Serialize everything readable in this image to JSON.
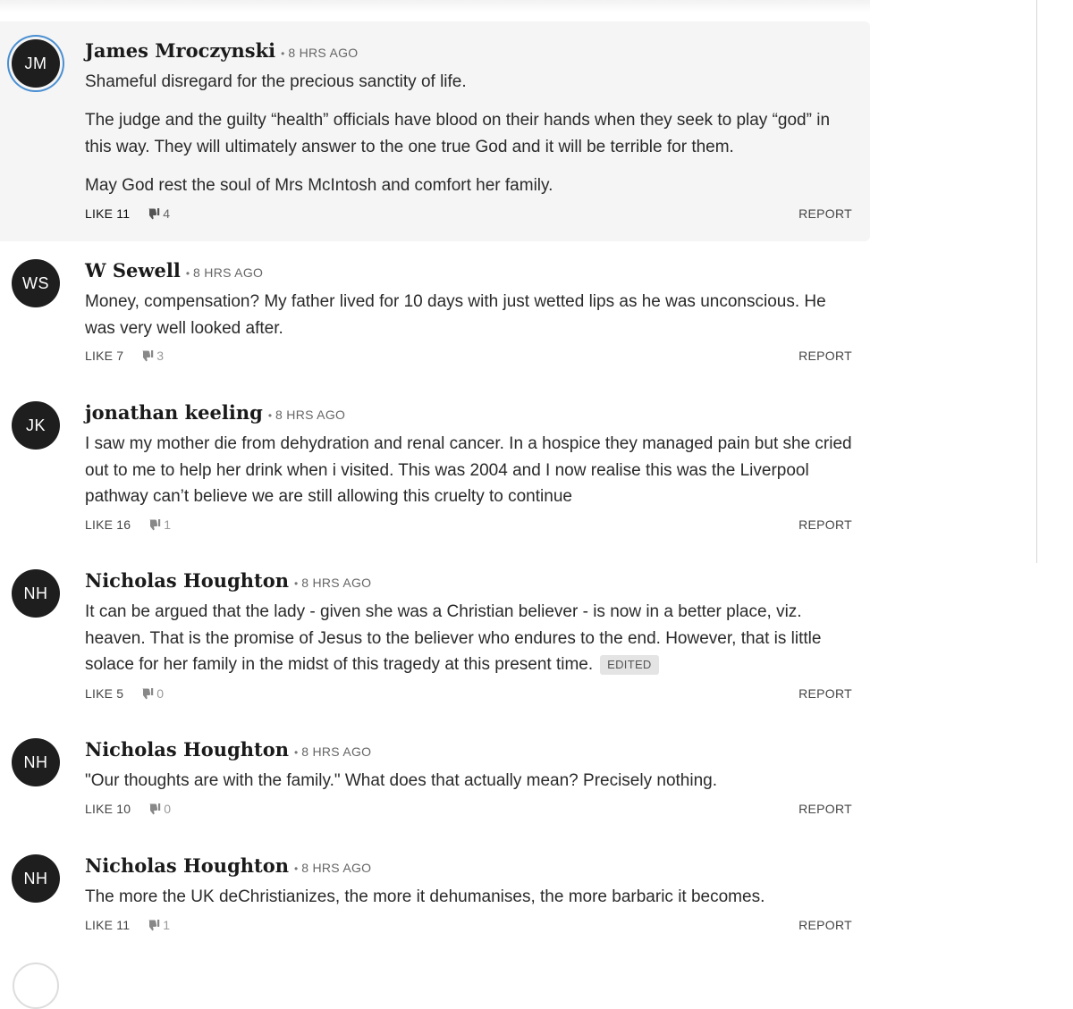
{
  "comments": [
    {
      "initials": "JM",
      "author": "James Mroczynski",
      "time": "8 HRS AGO",
      "paragraphs": [
        "Shameful disregard for the precious sanctity of life.",
        "The judge and the guilty “health” officials have blood on their hands when they seek to play “god” in this way. They will ultimately answer to the one true God and it will be terrible for them.",
        "May God rest the soul of Mrs McIntosh and comfort her family."
      ],
      "like_label": "LIKE 11",
      "dislike_count": "4",
      "report_label": "REPORT"
    },
    {
      "initials": "WS",
      "author": "W Sewell",
      "time": "8 HRS AGO",
      "paragraphs": [
        "Money, compensation? My father lived for 10 days with just wetted lips as he was unconscious. He was very well looked after."
      ],
      "like_label": "LIKE 7",
      "dislike_count": "3",
      "report_label": "REPORT"
    },
    {
      "initials": "JK",
      "author": "jonathan keeling",
      "time": "8 HRS AGO",
      "paragraphs": [
        "I saw my mother die from dehydration and renal cancer. In a hospice they managed pain but she cried out to me to help her drink when i visited. This was 2004 and I now realise this was the Liverpool pathway can’t believe we are still allowing this cruelty to continue"
      ],
      "like_label": "LIKE 16",
      "dislike_count": "1",
      "report_label": "REPORT"
    },
    {
      "initials": "NH",
      "author": "Nicholas Houghton",
      "time": "8 HRS AGO",
      "paragraphs": [
        "It can be argued that the lady - given she was a Christian believer - is now in a better place, viz. heaven. That is the promise of Jesus to the believer who endures to the end. However, that is little solace for her family in the midst of this tragedy at this present time."
      ],
      "edited_label": "EDITED",
      "like_label": "LIKE 5",
      "dislike_count": "0",
      "report_label": "REPORT"
    },
    {
      "initials": "NH",
      "author": "Nicholas Houghton",
      "time": "8 HRS AGO",
      "paragraphs": [
        "\"Our thoughts are with the family.\" What does that actually mean? Precisely nothing."
      ],
      "like_label": "LIKE 10",
      "dislike_count": "0",
      "report_label": "REPORT"
    },
    {
      "initials": "NH",
      "author": "Nicholas Houghton",
      "time": "8 HRS AGO",
      "paragraphs": [
        "The more the UK deChristianizes, the more it dehumanises, the more barbaric it becomes."
      ],
      "like_label": "LIKE 11",
      "dislike_count": "1",
      "report_label": "REPORT"
    }
  ]
}
